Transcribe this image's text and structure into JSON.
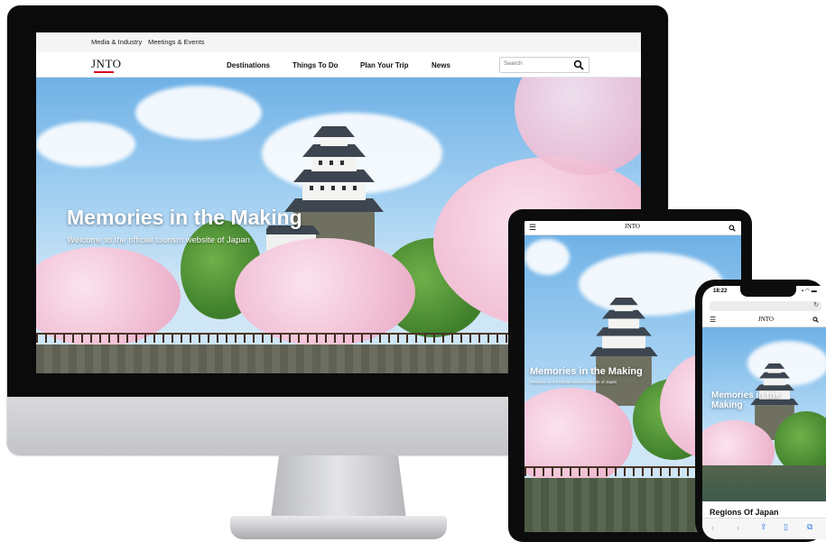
{
  "desktop": {
    "topbar": {
      "media_link": "Media & Industry",
      "meetings_link": "Meetings & Events"
    },
    "logo": "JNTO",
    "nav": [
      "Destinations",
      "Things To Do",
      "Plan Your Trip",
      "News"
    ],
    "search": {
      "placeholder": "Search"
    },
    "hero": {
      "title": "Memories in the Making",
      "subtitle": "Welcome to the official tourism website of Japan"
    }
  },
  "tablet": {
    "logo": "JNTO",
    "hero": {
      "title": "Memories in the Making",
      "subtitle": "Welcome to the official tourism website of Japan"
    }
  },
  "phone": {
    "status": {
      "time": "18:22"
    },
    "logo": "JNTO",
    "hero": {
      "title": "Memories in the Making"
    },
    "section_heading": "Regions Of Japan"
  },
  "icons": [
    "search-icon",
    "menu-icon",
    "reload-icon",
    "share-icon",
    "bookmarks-icon",
    "tabs-icon",
    "back-icon",
    "forward-icon"
  ],
  "colors": {
    "accent": "#d7001d",
    "nav_text": "#111111",
    "sky": "#8ec3ec"
  }
}
